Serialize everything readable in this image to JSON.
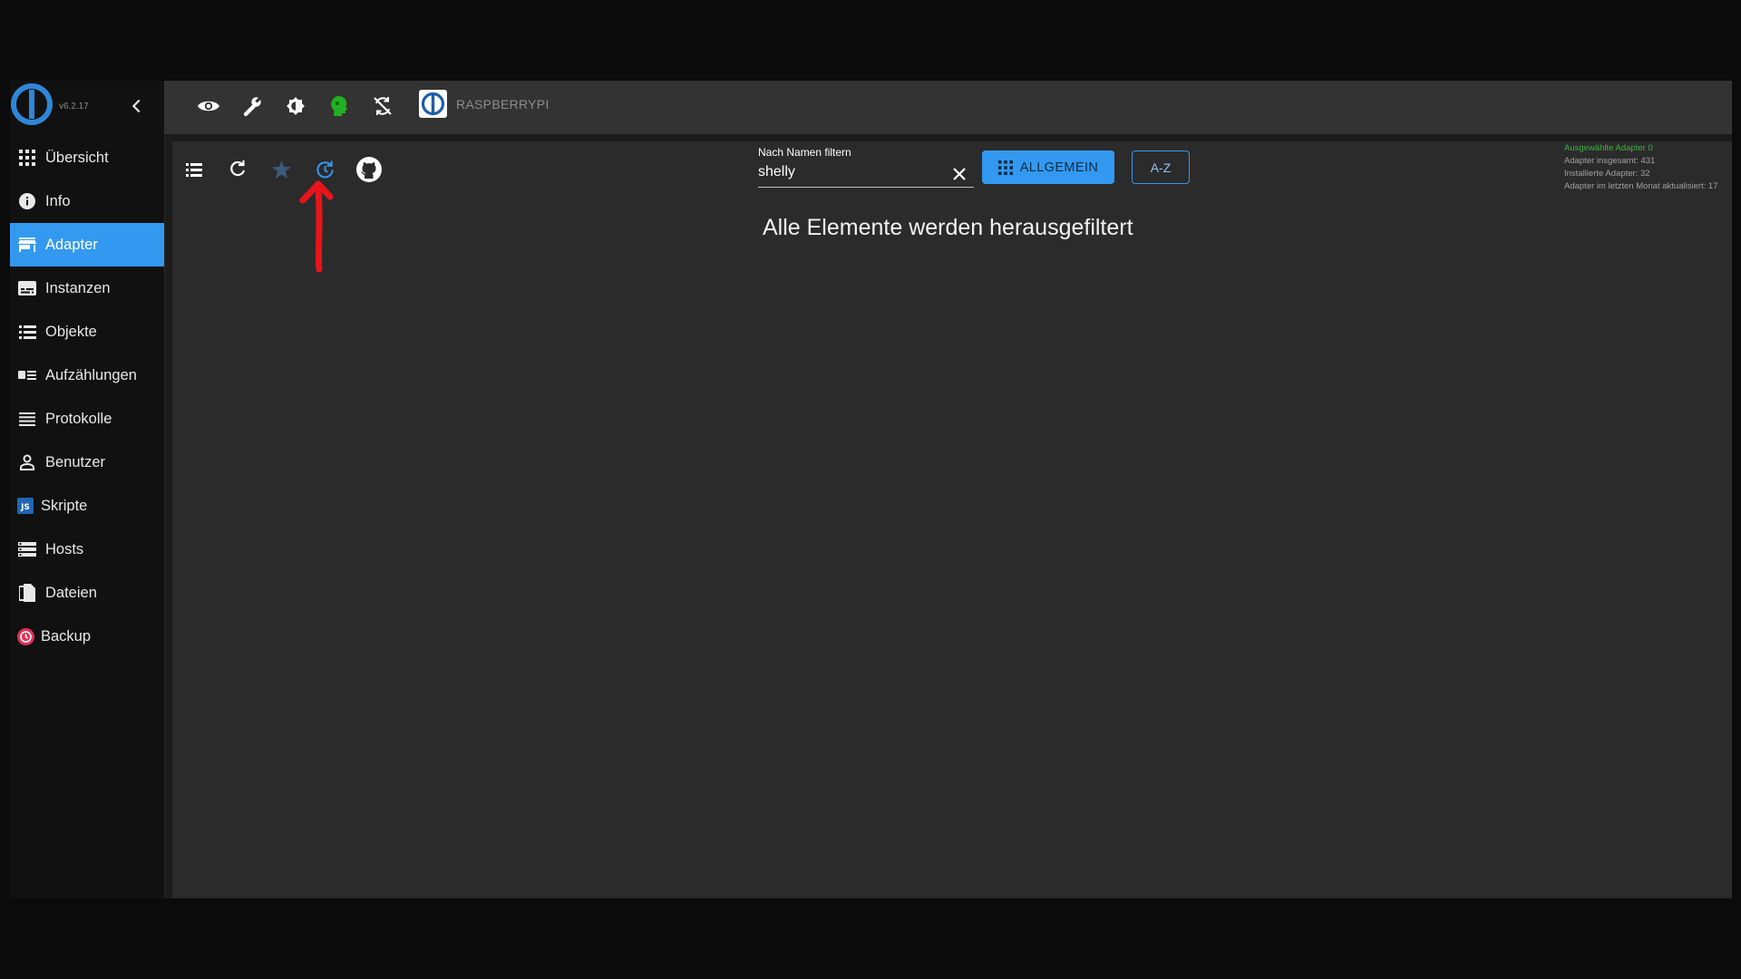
{
  "app": {
    "version": "v6.2.17",
    "host_name": "RASPBERRYPI"
  },
  "sidebar": {
    "items": [
      {
        "label": "Übersicht",
        "icon": "grid-icon"
      },
      {
        "label": "Info",
        "icon": "info-icon"
      },
      {
        "label": "Adapter",
        "icon": "store-icon",
        "active": true
      },
      {
        "label": "Instanzen",
        "icon": "subtitles-icon"
      },
      {
        "label": "Objekte",
        "icon": "list-icon"
      },
      {
        "label": "Aufzählungen",
        "icon": "enum-icon"
      },
      {
        "label": "Protokolle",
        "icon": "lines-icon"
      },
      {
        "label": "Benutzer",
        "icon": "user-icon"
      },
      {
        "label": "Skripte",
        "icon": "js-icon"
      },
      {
        "label": "Hosts",
        "icon": "storage-icon"
      },
      {
        "label": "Dateien",
        "icon": "files-icon"
      },
      {
        "label": "Backup",
        "icon": "backup-icon"
      }
    ]
  },
  "toolbar": {
    "icons": [
      "eye-icon",
      "wrench-icon",
      "brightness-icon",
      "expert-head-icon",
      "sync-off-icon"
    ]
  },
  "content": {
    "filter": {
      "label": "Nach Namen filtern",
      "value": "shelly"
    },
    "category_button": "ALLGEMEIN",
    "sort_button": "A-Z",
    "stats": {
      "selected": "Ausgewählte Adapter 0",
      "total": "Adapter insgesamt: 431",
      "installed": "Installierte Adapter: 32",
      "updated": "Adapter im letzten Monat aktualisiert: 17"
    },
    "empty_message": "Alle Elemente werden herausgefiltert"
  },
  "colors": {
    "accent": "#3399f0",
    "annotation": "#e8141b",
    "expert_green": "#22b022",
    "stats_green": "#3bb33b"
  }
}
